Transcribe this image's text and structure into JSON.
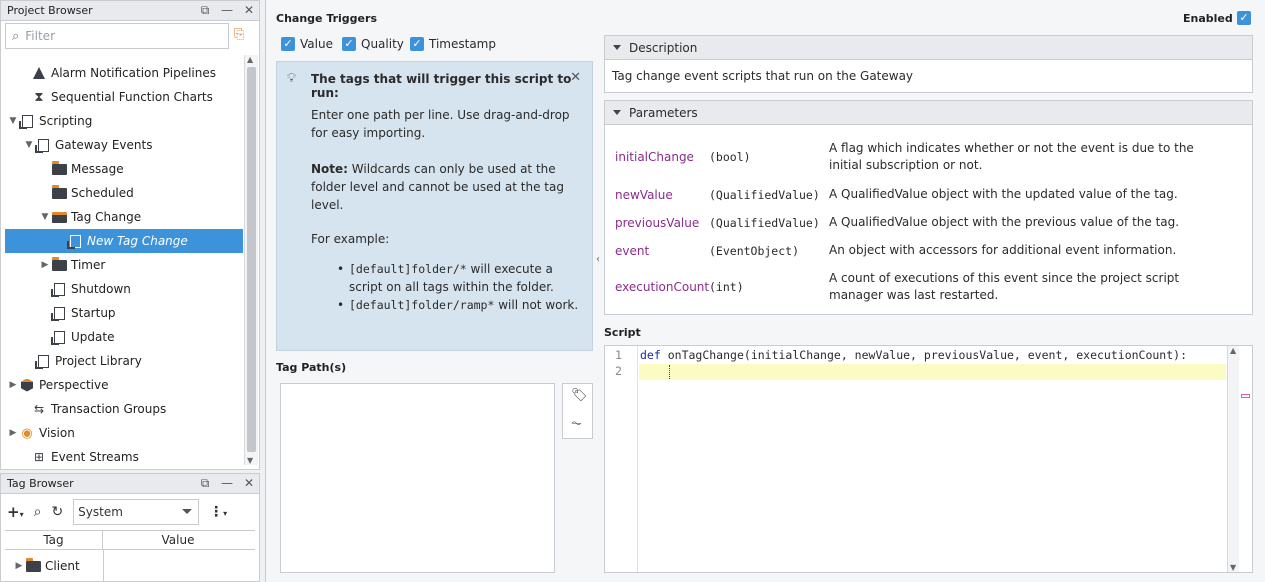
{
  "project_browser": {
    "title": "Project Browser",
    "filter_placeholder": "Filter",
    "items": [
      {
        "label": "Alarm Notification Pipelines"
      },
      {
        "label": "Sequential Function Charts"
      },
      {
        "label": "Scripting"
      },
      {
        "label": "Gateway Events"
      },
      {
        "label": "Message"
      },
      {
        "label": "Scheduled"
      },
      {
        "label": "Tag Change"
      },
      {
        "label": "New Tag Change"
      },
      {
        "label": "Timer"
      },
      {
        "label": "Shutdown"
      },
      {
        "label": "Startup"
      },
      {
        "label": "Update"
      },
      {
        "label": "Project Library"
      },
      {
        "label": "Perspective"
      },
      {
        "label": "Transaction Groups"
      },
      {
        "label": "Vision"
      },
      {
        "label": "Event Streams"
      }
    ]
  },
  "tag_browser": {
    "title": "Tag Browser",
    "provider": "System",
    "col_tag": "Tag",
    "col_value": "Value",
    "rows": [
      {
        "label": "Client"
      }
    ]
  },
  "editor": {
    "change_triggers": "Change Triggers",
    "enabled_label": "Enabled",
    "triggers": {
      "value": "Value",
      "quality": "Quality",
      "timestamp": "Timestamp"
    },
    "info": {
      "heading": "The tags that will trigger this script to run:",
      "p1": "Enter one path per line. Use drag-and-drop for easy importing.",
      "note_label": "Note:",
      "note_text": " Wildcards can only be used at the folder level and cannot be used at the tag level.",
      "example_label": "For example:",
      "ex1_code": "[default]folder/*",
      "ex1_text": " will execute a script on all tags within the folder.",
      "ex2_code": "[default]folder/ramp*",
      "ex2_text": " will not work."
    },
    "tag_paths_label": "Tag Path(s)",
    "description": {
      "title": "Description",
      "text": "Tag change event scripts that run on the Gateway"
    },
    "parameters": {
      "title": "Parameters",
      "rows": [
        {
          "name": "initialChange",
          "type": "(bool)",
          "desc": "A flag which indicates whether or not the event is due to the initial subscription or not."
        },
        {
          "name": "newValue",
          "type": "(QualifiedValue)",
          "desc": "A QualifiedValue object with the updated value of the tag."
        },
        {
          "name": "previousValue",
          "type": "(QualifiedValue)",
          "desc": "A QualifiedValue object with the previous value of the tag."
        },
        {
          "name": "event",
          "type": "(EventObject)",
          "desc": "An object with accessors for additional event information."
        },
        {
          "name": "executionCount",
          "type": "(int)",
          "desc": "A count of executions of this event since the project script manager was last restarted."
        }
      ]
    },
    "script_label": "Script",
    "code": {
      "line1_no": "1",
      "line2_no": "2",
      "kw": "def",
      "fn": "onTagChange",
      "args": "(initialChange, newValue, previousValue, event, executionCount):"
    }
  },
  "colors": {
    "accent": "#3d93d9",
    "param_name": "#8a2d8c",
    "info_bg": "#d5e4ef",
    "highlight_line": "#fbfbc4"
  },
  "icons": [
    "filter-search-icon",
    "locate-icon",
    "restore-icon",
    "minimize-icon",
    "close-icon",
    "lightbulb-icon",
    "tag-icon",
    "chart-icon",
    "add-icon",
    "search-icon",
    "refresh-icon",
    "more-icon"
  ]
}
